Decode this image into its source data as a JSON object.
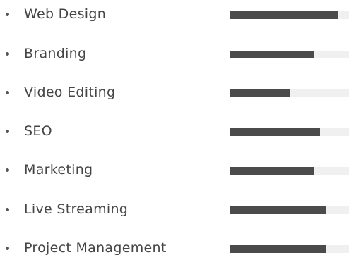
{
  "colors": {
    "text": "#454545",
    "bar_fill": "#4b4b4b",
    "bar_track": "#f0f0f0",
    "bullet": "#555555"
  },
  "skills": [
    {
      "label": "Web Design",
      "level": 0.91
    },
    {
      "label": "Branding",
      "level": 0.71
    },
    {
      "label": "Video Editing",
      "level": 0.51
    },
    {
      "label": "SEO",
      "level": 0.76
    },
    {
      "label": "Marketing",
      "level": 0.71
    },
    {
      "label": "Live Streaming",
      "level": 0.81
    },
    {
      "label": "Project Management",
      "level": 0.81
    }
  ]
}
